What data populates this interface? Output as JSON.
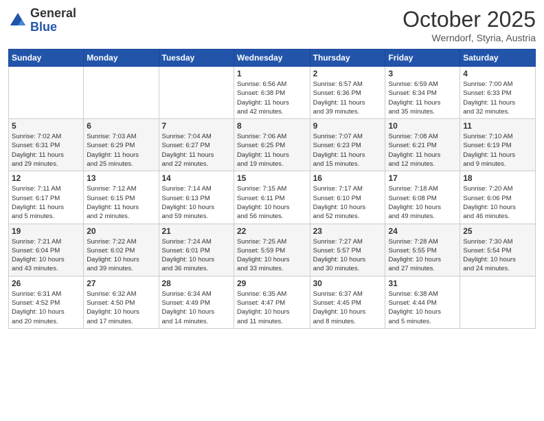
{
  "header": {
    "logo_general": "General",
    "logo_blue": "Blue",
    "month_title": "October 2025",
    "location": "Werndorf, Styria, Austria"
  },
  "days_of_week": [
    "Sunday",
    "Monday",
    "Tuesday",
    "Wednesday",
    "Thursday",
    "Friday",
    "Saturday"
  ],
  "weeks": [
    [
      {
        "day": "",
        "info": ""
      },
      {
        "day": "",
        "info": ""
      },
      {
        "day": "",
        "info": ""
      },
      {
        "day": "1",
        "info": "Sunrise: 6:56 AM\nSunset: 6:38 PM\nDaylight: 11 hours\nand 42 minutes."
      },
      {
        "day": "2",
        "info": "Sunrise: 6:57 AM\nSunset: 6:36 PM\nDaylight: 11 hours\nand 39 minutes."
      },
      {
        "day": "3",
        "info": "Sunrise: 6:59 AM\nSunset: 6:34 PM\nDaylight: 11 hours\nand 35 minutes."
      },
      {
        "day": "4",
        "info": "Sunrise: 7:00 AM\nSunset: 6:33 PM\nDaylight: 11 hours\nand 32 minutes."
      }
    ],
    [
      {
        "day": "5",
        "info": "Sunrise: 7:02 AM\nSunset: 6:31 PM\nDaylight: 11 hours\nand 29 minutes."
      },
      {
        "day": "6",
        "info": "Sunrise: 7:03 AM\nSunset: 6:29 PM\nDaylight: 11 hours\nand 25 minutes."
      },
      {
        "day": "7",
        "info": "Sunrise: 7:04 AM\nSunset: 6:27 PM\nDaylight: 11 hours\nand 22 minutes."
      },
      {
        "day": "8",
        "info": "Sunrise: 7:06 AM\nSunset: 6:25 PM\nDaylight: 11 hours\nand 19 minutes."
      },
      {
        "day": "9",
        "info": "Sunrise: 7:07 AM\nSunset: 6:23 PM\nDaylight: 11 hours\nand 15 minutes."
      },
      {
        "day": "10",
        "info": "Sunrise: 7:08 AM\nSunset: 6:21 PM\nDaylight: 11 hours\nand 12 minutes."
      },
      {
        "day": "11",
        "info": "Sunrise: 7:10 AM\nSunset: 6:19 PM\nDaylight: 11 hours\nand 9 minutes."
      }
    ],
    [
      {
        "day": "12",
        "info": "Sunrise: 7:11 AM\nSunset: 6:17 PM\nDaylight: 11 hours\nand 5 minutes."
      },
      {
        "day": "13",
        "info": "Sunrise: 7:12 AM\nSunset: 6:15 PM\nDaylight: 11 hours\nand 2 minutes."
      },
      {
        "day": "14",
        "info": "Sunrise: 7:14 AM\nSunset: 6:13 PM\nDaylight: 10 hours\nand 59 minutes."
      },
      {
        "day": "15",
        "info": "Sunrise: 7:15 AM\nSunset: 6:11 PM\nDaylight: 10 hours\nand 56 minutes."
      },
      {
        "day": "16",
        "info": "Sunrise: 7:17 AM\nSunset: 6:10 PM\nDaylight: 10 hours\nand 52 minutes."
      },
      {
        "day": "17",
        "info": "Sunrise: 7:18 AM\nSunset: 6:08 PM\nDaylight: 10 hours\nand 49 minutes."
      },
      {
        "day": "18",
        "info": "Sunrise: 7:20 AM\nSunset: 6:06 PM\nDaylight: 10 hours\nand 46 minutes."
      }
    ],
    [
      {
        "day": "19",
        "info": "Sunrise: 7:21 AM\nSunset: 6:04 PM\nDaylight: 10 hours\nand 43 minutes."
      },
      {
        "day": "20",
        "info": "Sunrise: 7:22 AM\nSunset: 6:02 PM\nDaylight: 10 hours\nand 39 minutes."
      },
      {
        "day": "21",
        "info": "Sunrise: 7:24 AM\nSunset: 6:01 PM\nDaylight: 10 hours\nand 36 minutes."
      },
      {
        "day": "22",
        "info": "Sunrise: 7:25 AM\nSunset: 5:59 PM\nDaylight: 10 hours\nand 33 minutes."
      },
      {
        "day": "23",
        "info": "Sunrise: 7:27 AM\nSunset: 5:57 PM\nDaylight: 10 hours\nand 30 minutes."
      },
      {
        "day": "24",
        "info": "Sunrise: 7:28 AM\nSunset: 5:55 PM\nDaylight: 10 hours\nand 27 minutes."
      },
      {
        "day": "25",
        "info": "Sunrise: 7:30 AM\nSunset: 5:54 PM\nDaylight: 10 hours\nand 24 minutes."
      }
    ],
    [
      {
        "day": "26",
        "info": "Sunrise: 6:31 AM\nSunset: 4:52 PM\nDaylight: 10 hours\nand 20 minutes."
      },
      {
        "day": "27",
        "info": "Sunrise: 6:32 AM\nSunset: 4:50 PM\nDaylight: 10 hours\nand 17 minutes."
      },
      {
        "day": "28",
        "info": "Sunrise: 6:34 AM\nSunset: 4:49 PM\nDaylight: 10 hours\nand 14 minutes."
      },
      {
        "day": "29",
        "info": "Sunrise: 6:35 AM\nSunset: 4:47 PM\nDaylight: 10 hours\nand 11 minutes."
      },
      {
        "day": "30",
        "info": "Sunrise: 6:37 AM\nSunset: 4:45 PM\nDaylight: 10 hours\nand 8 minutes."
      },
      {
        "day": "31",
        "info": "Sunrise: 6:38 AM\nSunset: 4:44 PM\nDaylight: 10 hours\nand 5 minutes."
      },
      {
        "day": "",
        "info": ""
      }
    ]
  ]
}
